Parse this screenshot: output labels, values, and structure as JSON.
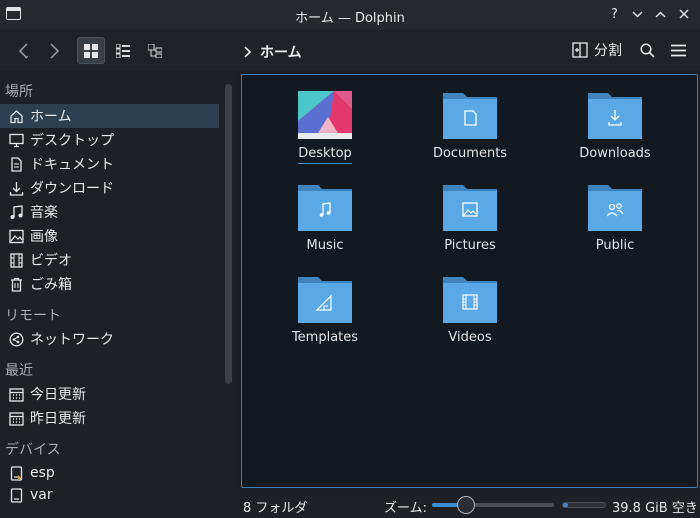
{
  "window": {
    "title": "ホーム — Dolphin"
  },
  "toolbar": {
    "breadcrumb": "ホーム",
    "split_label": "分割"
  },
  "sidebar": {
    "sections": {
      "places": "場所",
      "remote": "リモート",
      "recent": "最近",
      "devices": "デバイス"
    },
    "places": [
      {
        "label": "ホーム",
        "icon": "home-icon",
        "selected": true
      },
      {
        "label": "デスクトップ",
        "icon": "desktop-icon"
      },
      {
        "label": "ドキュメント",
        "icon": "document-icon"
      },
      {
        "label": "ダウンロード",
        "icon": "download-icon"
      },
      {
        "label": "音楽",
        "icon": "music-icon"
      },
      {
        "label": "画像",
        "icon": "image-icon"
      },
      {
        "label": "ビデオ",
        "icon": "video-icon"
      },
      {
        "label": "ごみ箱",
        "icon": "trash-icon"
      }
    ],
    "remote": [
      {
        "label": "ネットワーク",
        "icon": "network-icon"
      }
    ],
    "recent": [
      {
        "label": "今日更新",
        "icon": "calendar-icon"
      },
      {
        "label": "昨日更新",
        "icon": "calendar-icon"
      }
    ],
    "devices": [
      {
        "label": "esp",
        "icon": "drive-icon"
      },
      {
        "label": "var",
        "icon": "drive-icon"
      }
    ]
  },
  "files": [
    {
      "name": "Desktop",
      "type": "desktop-thumbnail"
    },
    {
      "name": "Documents",
      "type": "folder-documents-icon"
    },
    {
      "name": "Downloads",
      "type": "folder-downloads-icon"
    },
    {
      "name": "Music",
      "type": "folder-music-icon"
    },
    {
      "name": "Pictures",
      "type": "folder-pictures-icon"
    },
    {
      "name": "Public",
      "type": "folder-public-icon"
    },
    {
      "name": "Templates",
      "type": "folder-templates-icon"
    },
    {
      "name": "Videos",
      "type": "folder-videos-icon"
    }
  ],
  "status": {
    "summary": "8 フォルダ",
    "zoom_label": "ズーム:",
    "zoom_level": 0.28,
    "free_space": "39.8 GiB 空き",
    "used_fraction": 0.12
  },
  "colors": {
    "accent": "#3d8bd0",
    "folder": "#5aa9e6",
    "folder_tab": "#3f84bd",
    "selection": "#2b3f51"
  }
}
